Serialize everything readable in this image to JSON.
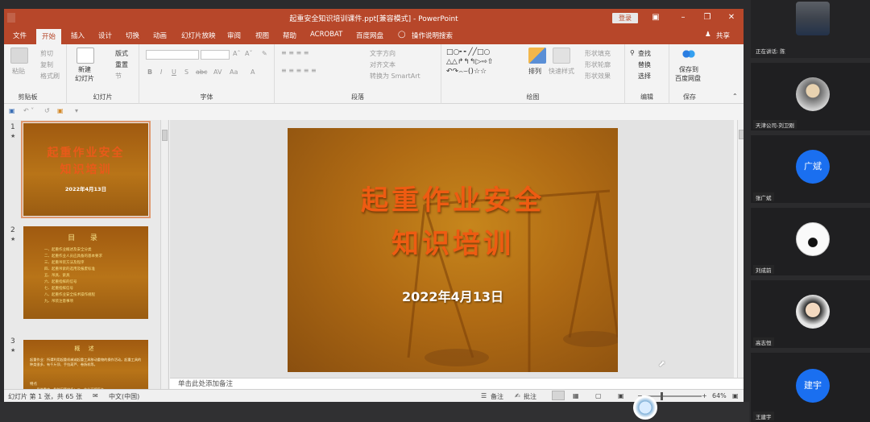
{
  "window": {
    "title": "起重安全知识培训课件.ppt[兼容模式] - PowerPoint",
    "login_label": "登录",
    "share_label": "共享"
  },
  "tabs": [
    "文件",
    "开始",
    "插入",
    "设计",
    "切换",
    "动画",
    "幻灯片放映",
    "审阅",
    "视图",
    "帮助",
    "ACROBAT",
    "百度网盘",
    "操作说明搜索"
  ],
  "active_tab": "开始",
  "ribbon": {
    "clipboard": {
      "paste": "粘贴",
      "cut": "剪切",
      "copy": "复制",
      "format_painter": "格式刷",
      "label": "剪贴板"
    },
    "slides": {
      "new_slide": "新建",
      "new_slide_2": "幻灯片",
      "layout": "版式",
      "reset": "重置",
      "section": "节",
      "label": "幻灯片"
    },
    "font": {
      "label": "字体"
    },
    "paragraph": {
      "text_direction": "文字方向",
      "align_text": "对齐文本",
      "smartart": "转换为 SmartArt",
      "label": "段落"
    },
    "drawing": {
      "arrange": "排列",
      "quick_styles": "快速样式",
      "shape_fill": "形状填充",
      "shape_outline": "形状轮廓",
      "shape_effects": "形状效果",
      "label": "绘图"
    },
    "editing": {
      "find": "查找",
      "replace": "替换",
      "select": "选择",
      "label": "编辑"
    },
    "save": {
      "line1": "保存到",
      "line2": "百度网盘",
      "label": "保存"
    }
  },
  "slide1": {
    "title_line1": "起重作业安全",
    "title_line2": "知识培训",
    "date": "2022年4月13日"
  },
  "thumbs": [
    {
      "num": "1",
      "title_line1": "起重作业安全",
      "title_line2": "知识培训",
      "date": "2022年4月13日"
    },
    {
      "num": "2",
      "title": "目 录",
      "items": [
        "一、起重作业概述及安全分类",
        "二、起重作业人员应具备的基本要求",
        "三、起重吊装方法及程序",
        "四、起重吊索的选用及报废标准",
        "五、吊具、索具",
        "六、起重指挥的信号",
        "七、起重指挥信号",
        "八、起重作业安全技术操作规程",
        "九、吊装注意事项"
      ]
    },
    {
      "num": "3",
      "title": "概 述",
      "body": "起重作业：所谓利用起重机械或起重工具移动重物的操作活动。起重工具的种类很多，有千斤顶、手拉葫芦、卷扬机等。",
      "sub": "特点",
      "list": "一、吊件重大、危险因素较多；二、作业环境复杂"
    }
  ],
  "notes_placeholder": "单击此处添加备注",
  "status": {
    "slide_info": "幻灯片 第 1 张，共 65 张",
    "language": "中文(中国)",
    "notes_btn": "备注",
    "comments_btn": "批注",
    "zoom": "64%"
  },
  "participants": [
    {
      "name": "正在讲话: 陈"
    },
    {
      "name": "天津公司-刘卫刚"
    },
    {
      "name": "张广斌",
      "initials": "广斌"
    },
    {
      "name": "刘成前"
    },
    {
      "name": "高志恒"
    },
    {
      "name": "王建宇",
      "initials": "建宇"
    }
  ],
  "colors": {
    "accent": "#b7472a",
    "slide_title": "#ee5b12",
    "avatar_blue": "#1a6ff0"
  }
}
